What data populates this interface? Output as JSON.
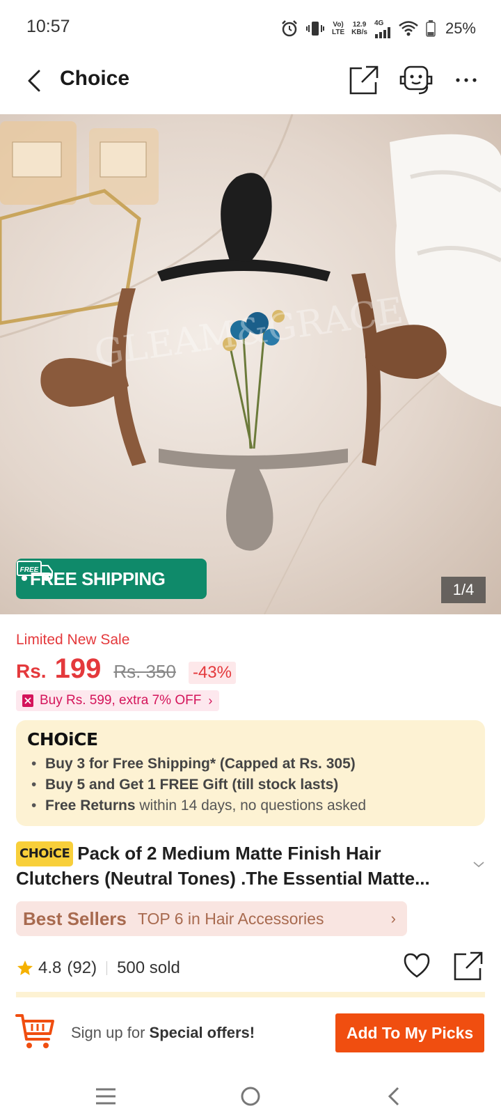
{
  "status_bar": {
    "time": "10:57",
    "network_top": "Vo)",
    "network_bottom": "LTE",
    "speed_top": "12.9",
    "speed_bottom": "KB/s",
    "signal_label": "4G",
    "battery": "25%"
  },
  "nav": {
    "title": "Choice"
  },
  "hero": {
    "free_shipping_label": "FREE SHIPPING",
    "free_badge": "FREE",
    "counter": "1/4",
    "watermark": "GLEAM&GRACE"
  },
  "price": {
    "sale_label": "Limited New Sale",
    "currency": "Rs.",
    "value": "199",
    "old_price": "Rs. 350",
    "discount": "-43%",
    "promo": "Buy Rs. 599, extra 7% OFF"
  },
  "choice": {
    "logo": "CHOiCE",
    "items": [
      {
        "strong": "Buy 3 for  Free Shipping* (Capped at Rs. 305)",
        "rest": ""
      },
      {
        "strong": "Buy 5 and Get 1 FREE Gift (till stock lasts)",
        "rest": ""
      },
      {
        "strong": "Free Returns",
        "rest": " within 14 days, no questions asked"
      }
    ]
  },
  "product": {
    "tag": "CHOiCE",
    "title": "Pack of 2 Medium Matte Finish Hair Clutchers (Neutral Tones) .The Essential Matte..."
  },
  "best_sellers": {
    "title": "Best Sellers",
    "text": "TOP 6 in Hair Accessories"
  },
  "rating": {
    "score": "4.8",
    "count": "(92)",
    "sold": "500 sold"
  },
  "bottom": {
    "signup_prefix": "Sign up for ",
    "signup_strong": "Special offers!",
    "add_button": "Add To My Picks"
  },
  "colors": {
    "accent_red": "#e4393c",
    "cta_orange": "#f04e10",
    "free_ship_green": "#0f8a6a",
    "choice_bg": "#fdf2d3"
  }
}
